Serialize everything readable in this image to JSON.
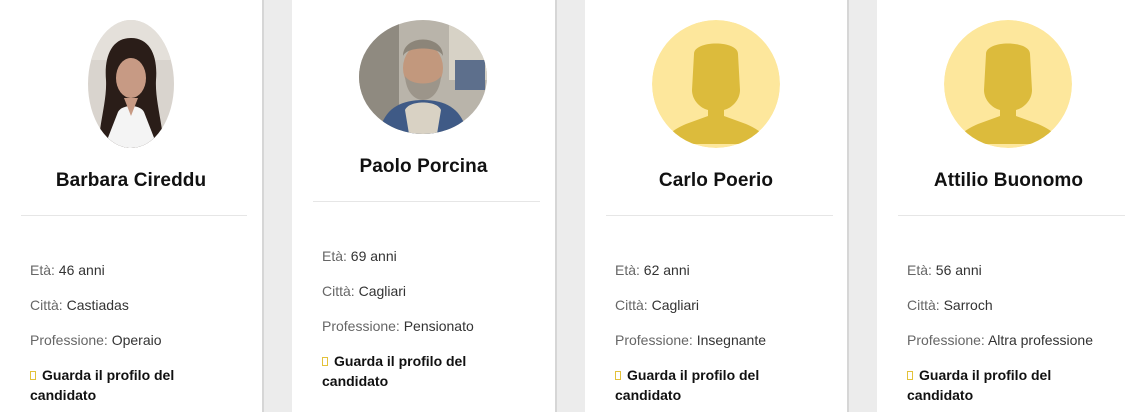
{
  "labels": {
    "age": "Età:",
    "city": "Città:",
    "profession": "Professione:",
    "link": "Guarda il profilo del candidato"
  },
  "colors": {
    "placeholder_bg": "#fde79c",
    "placeholder_figure": "#dcbb3c",
    "link_marker": "#e3c23a"
  },
  "candidates": [
    {
      "name": "Barbara Cireddu",
      "age": "46 anni",
      "city": "Castiadas",
      "profession": "Operaio",
      "avatar": "photo-woman-avatar"
    },
    {
      "name": "Paolo Porcina",
      "age": "69 anni",
      "city": "Cagliari",
      "profession": "Pensionato",
      "avatar": "photo-bearded-man-avatar"
    },
    {
      "name": "Carlo Poerio",
      "age": "62 anni",
      "city": "Cagliari",
      "profession": "Insegnante",
      "avatar": "default-user-silhouette-icon"
    },
    {
      "name": "Attilio Buonomo",
      "age": "56 anni",
      "city": "Sarroch",
      "profession": "Altra professione",
      "avatar": "default-user-silhouette-icon"
    }
  ]
}
